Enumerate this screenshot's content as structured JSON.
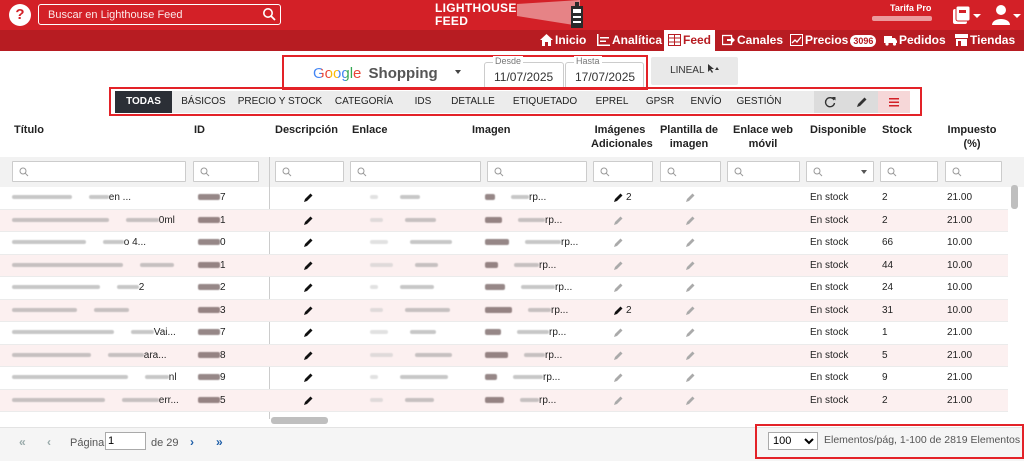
{
  "topbar": {
    "search_placeholder": "Buscar en Lighthouse Feed",
    "logo_line1": "LIGHTHOUSE",
    "logo_line2": "FEED",
    "tarifa": "Tarifa Pro",
    "colors": {
      "red": "#d32027",
      "dark_red": "#b71c22",
      "highlight": "#e32228"
    }
  },
  "nav": {
    "items": [
      {
        "label": "Inicio",
        "icon": "home-icon"
      },
      {
        "label": "Analítica",
        "icon": "analytics-icon"
      },
      {
        "label": "Feed",
        "icon": "table-icon",
        "active": true
      },
      {
        "label": "Canales",
        "icon": "export-icon"
      },
      {
        "label": "Precios",
        "icon": "chart-icon",
        "badge": "3096"
      },
      {
        "label": "Pedidos",
        "icon": "truck-icon"
      },
      {
        "label": "Tiendas",
        "icon": "store-icon"
      }
    ]
  },
  "filters": {
    "source_google": "Google",
    "source_product": "Shopping",
    "desde_label": "Desde",
    "desde_value": "11/07/2025",
    "hasta_label": "Hasta",
    "hasta_value": "17/07/2025",
    "lineal_label": "LINEAL"
  },
  "tabs": [
    "TODAS",
    "BÁSICOS",
    "PRECIO Y STOCK",
    "CATEGORÍA",
    "IDS",
    "DETALLE",
    "ETIQUETADO",
    "EPREL",
    "GPSR",
    "ENVÍO",
    "GESTIÓN"
  ],
  "table": {
    "headers": {
      "titulo": "Título",
      "id": "ID",
      "descripcion": "Descripción",
      "enlace": "Enlace",
      "imagen": "Imagen",
      "imagenes_1": "Imágenes",
      "imagenes_2": "Adicionales",
      "plantilla_1": "Plantilla de",
      "plantilla_2": "imagen",
      "enlace_web_1": "Enlace web",
      "enlace_web_2": "móvil",
      "disponible": "Disponible",
      "stock": "Stock",
      "impuesto_1": "Impuesto",
      "impuesto_2": "(%)"
    },
    "rows": [
      {
        "title_end": "en ...",
        "id_end": "7",
        "img_end": "rp...",
        "extra": "2",
        "disponible": "En stock",
        "stock": "2",
        "tax": "21.00"
      },
      {
        "title_end": "0ml",
        "id_end": "1",
        "img_end": "rp...",
        "extra": "",
        "disponible": "En stock",
        "stock": "2",
        "tax": "21.00"
      },
      {
        "title_end": "o 4...",
        "id_end": "0",
        "img_end": "rp...",
        "extra": "",
        "disponible": "En stock",
        "stock": "66",
        "tax": "10.00"
      },
      {
        "title_end": "",
        "id_end": "1",
        "img_end": "rp...",
        "extra": "",
        "disponible": "En stock",
        "stock": "44",
        "tax": "10.00"
      },
      {
        "title_end": "2",
        "id_end": "2",
        "img_end": "rp...",
        "extra": "",
        "disponible": "En stock",
        "stock": "24",
        "tax": "10.00"
      },
      {
        "title_end": "",
        "id_end": "3",
        "img_end": "rp...",
        "extra": "2",
        "disponible": "En stock",
        "stock": "31",
        "tax": "10.00"
      },
      {
        "title_end": "Vai...",
        "id_end": "7",
        "img_end": "rp...",
        "extra": "",
        "disponible": "En stock",
        "stock": "1",
        "tax": "21.00"
      },
      {
        "title_end": "ara...",
        "id_end": "8",
        "img_end": "rp...",
        "extra": "",
        "disponible": "En stock",
        "stock": "5",
        "tax": "21.00"
      },
      {
        "title_end": "nl",
        "id_end": "9",
        "img_end": "rp...",
        "extra": "",
        "disponible": "En stock",
        "stock": "9",
        "tax": "21.00"
      },
      {
        "title_end": "err...",
        "id_end": "5",
        "img_end": "rp...",
        "extra": "",
        "disponible": "En stock",
        "stock": "2",
        "tax": "21.00"
      }
    ]
  },
  "footer": {
    "pagina_label": "Página",
    "page_value": "1",
    "de_label": "de 29",
    "per_page": "100",
    "pager_text": "Elementos/pág, 1-100 de 2819 Elementos"
  }
}
